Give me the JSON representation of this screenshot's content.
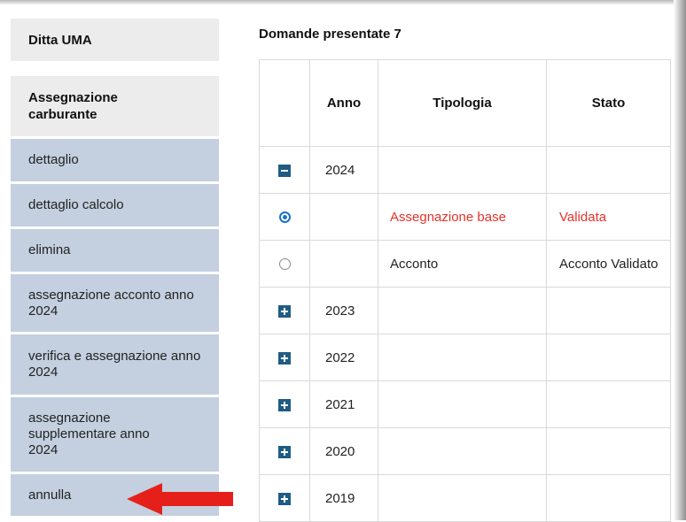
{
  "sidebar": {
    "header1": "Ditta UMA",
    "header2": "Assegnazione carburante",
    "items": [
      {
        "label": "dettaglio"
      },
      {
        "label": "dettaglio calcolo"
      },
      {
        "label": "elimina"
      },
      {
        "label": "assegnazione acconto anno 2024"
      },
      {
        "label": "verifica e assegnazione anno 2024"
      },
      {
        "label": "assegnazione supplementare anno 2024"
      },
      {
        "label": "annulla"
      }
    ]
  },
  "main": {
    "title": "Domande presentate 7",
    "columns": [
      "",
      "Anno",
      "Tipologia",
      "Stato"
    ],
    "rows": [
      {
        "control": "minus-icon",
        "anno": "2024",
        "tipologia": "",
        "stato": ""
      },
      {
        "control": "radio-selected",
        "anno": "",
        "tipologia": "Assegnazione base",
        "stato": "Validata"
      },
      {
        "control": "radio",
        "anno": "",
        "tipologia": "Acconto",
        "stato": "Acconto Validato"
      },
      {
        "control": "plus-icon",
        "anno": "2023",
        "tipologia": "",
        "stato": ""
      },
      {
        "control": "plus-icon",
        "anno": "2022",
        "tipologia": "",
        "stato": ""
      },
      {
        "control": "plus-icon",
        "anno": "2021",
        "tipologia": "",
        "stato": ""
      },
      {
        "control": "plus-icon",
        "anno": "2020",
        "tipologia": "",
        "stato": ""
      },
      {
        "control": "plus-icon",
        "anno": "2019",
        "tipologia": "",
        "stato": ""
      }
    ]
  },
  "colors": {
    "sidebar_item_bg": "#c4d0df",
    "sidebar_header_bg": "#ececec",
    "highlight_text": "#e5332a",
    "icon_blue": "#1f5c83",
    "arrow": "#e5201b"
  }
}
